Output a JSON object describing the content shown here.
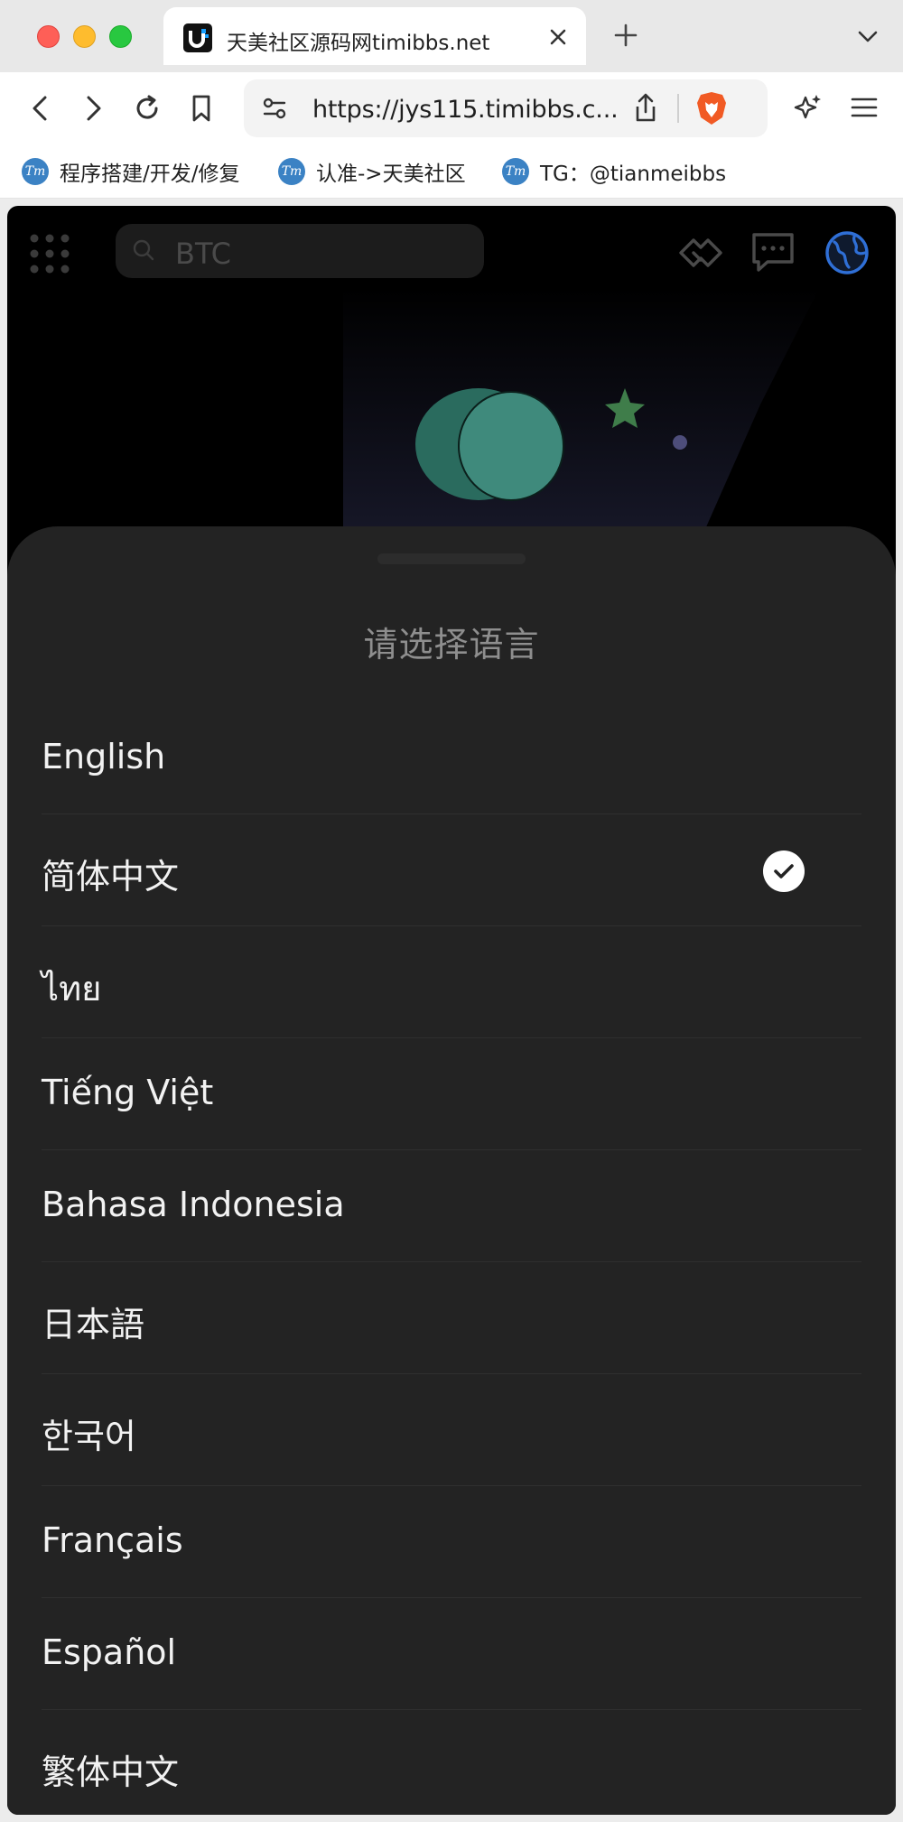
{
  "browser": {
    "tab_title": "天美社区源码网timibbs.net",
    "url": "https://jys115.timibbs.c...",
    "bookmarks": [
      {
        "label": "程序搭建/开发/修复",
        "icon_text": "Tm"
      },
      {
        "label": "认准->天美社区",
        "icon_text": "Tm"
      },
      {
        "label": "TG：@tianmeibbs",
        "icon_text": "Tm"
      }
    ]
  },
  "header": {
    "search_placeholder": "BTC",
    "icons": [
      "grid-icon",
      "handshake-icon",
      "message-icon",
      "globe-icon"
    ]
  },
  "language_sheet": {
    "title": "请选择语言",
    "selected": "简体中文",
    "languages": [
      {
        "label": "English",
        "selected": false
      },
      {
        "label": "简体中文",
        "selected": true
      },
      {
        "label": "ไทย",
        "selected": false
      },
      {
        "label": "Tiếng Việt",
        "selected": false
      },
      {
        "label": "Bahasa Indonesia",
        "selected": false
      },
      {
        "label": "日本語",
        "selected": false
      },
      {
        "label": "한국어",
        "selected": false
      },
      {
        "label": "Français",
        "selected": false
      },
      {
        "label": "Español",
        "selected": false
      },
      {
        "label": "繁体中文",
        "selected": false
      }
    ]
  },
  "colors": {
    "page_bg": "#000000",
    "sheet_bg": "#232323",
    "accent_globe": "#2f6fd6",
    "check_bg": "#ffffff"
  }
}
